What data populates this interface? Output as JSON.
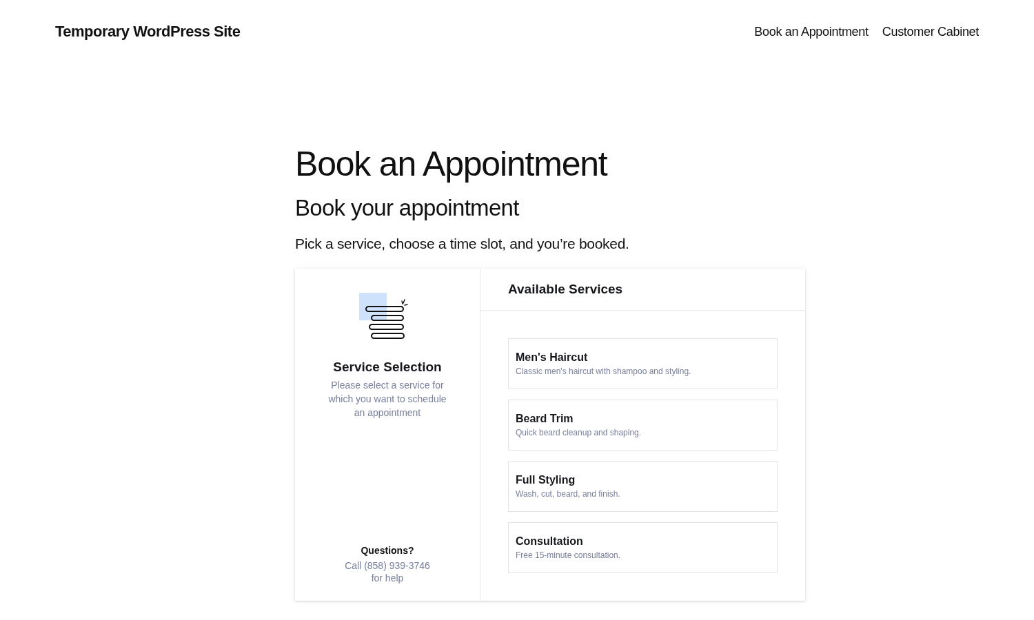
{
  "header": {
    "site_title": "Temporary WordPress Site",
    "nav": [
      {
        "label": "Book an Appointment"
      },
      {
        "label": "Customer Cabinet"
      }
    ]
  },
  "page": {
    "title": "Book an Appointment",
    "subtitle": "Book your appointment",
    "intro": "Pick a service, choose a time slot, and you’re booked."
  },
  "booking": {
    "sidebar": {
      "title": "Service Selection",
      "description": "Please select a service for which you want to schedule an appointment",
      "help_title": "Questions?",
      "help_text": "Call (858) 939-3746 for help"
    },
    "services_title": "Available Services",
    "services": [
      {
        "name": "Men's Haircut",
        "description": "Classic men's haircut with shampoo and styling."
      },
      {
        "name": "Beard Trim",
        "description": "Quick beard cleanup and shaping."
      },
      {
        "name": "Full Styling",
        "description": "Wash, cut, beard, and finish."
      },
      {
        "name": "Consultation",
        "description": "Free 15-minute consultation."
      }
    ]
  }
}
